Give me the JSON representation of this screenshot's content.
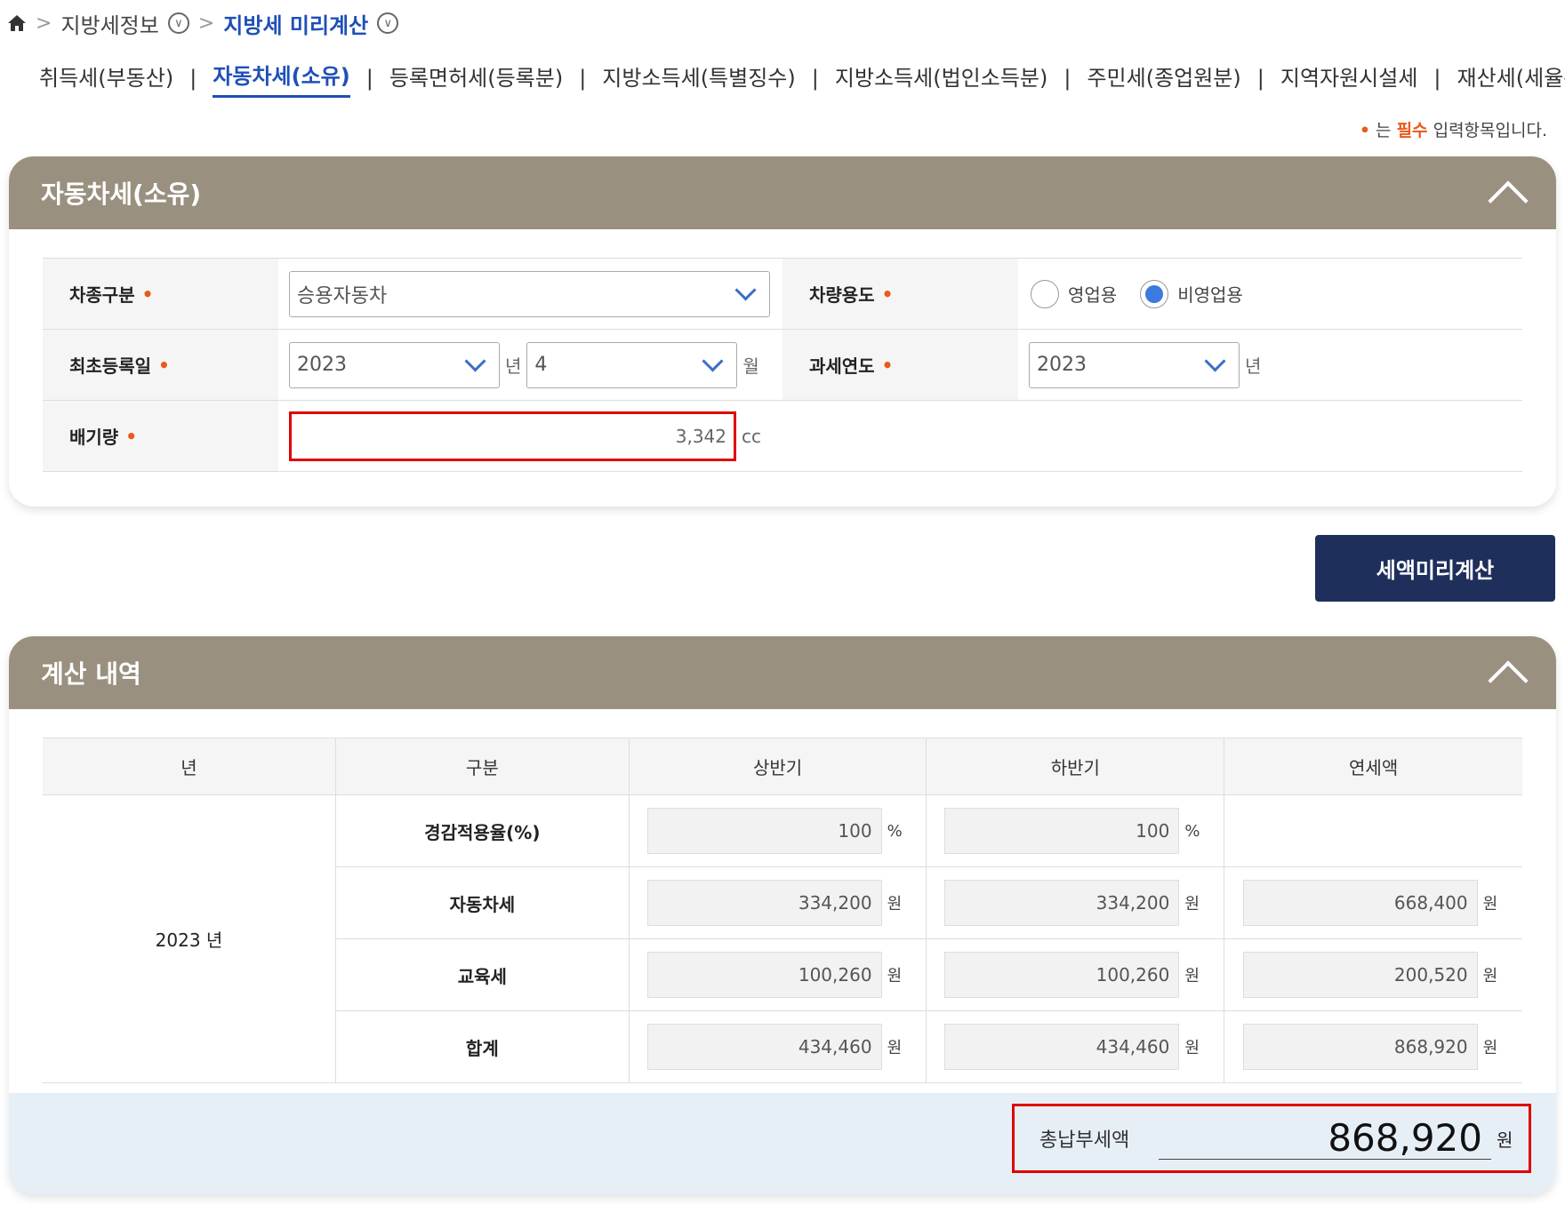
{
  "breadcrumb": {
    "level1": "지방세정보",
    "level2": "지방세 미리계산"
  },
  "tabs": [
    {
      "label": "취득세(부동산)"
    },
    {
      "label": "자동차세(소유)"
    },
    {
      "label": "등록면허세(등록분)"
    },
    {
      "label": "지방소득세(특별징수)"
    },
    {
      "label": "지방소득세(법인소득분)"
    },
    {
      "label": "주민세(종업원분)"
    },
    {
      "label": "지역자원시설세"
    },
    {
      "label": "재산세(세율특례)"
    }
  ],
  "required_note": {
    "dot": "•",
    "pre": "는 ",
    "em": "필수",
    "post": " 입력항목입니다."
  },
  "form_panel": {
    "title": "자동차세(소유)",
    "required_dot": "•",
    "vehicle_type": {
      "label": "차종구분",
      "value": "승용자동차"
    },
    "usage": {
      "label": "차량용도",
      "options": [
        "영업용",
        "비영업용"
      ],
      "selected": "비영업용"
    },
    "first_reg": {
      "label": "최초등록일",
      "year": "2023",
      "year_unit": "년",
      "month": "4",
      "month_unit": "월"
    },
    "tax_year": {
      "label": "과세연도",
      "value": "2023",
      "unit": "년"
    },
    "displacement": {
      "label": "배기량",
      "value": "3,342",
      "unit": "cc"
    }
  },
  "calc_button": "세액미리계산",
  "result_panel": {
    "title": "계산 내역",
    "headers": [
      "년",
      "구분",
      "상반기",
      "하반기",
      "연세액"
    ],
    "year_label": "2023 년",
    "rows": [
      {
        "kind": "경감적용율(%)",
        "h1": "100",
        "h2": "100",
        "annual": "",
        "unit": "%"
      },
      {
        "kind": "자동차세",
        "h1": "334,200",
        "h2": "334,200",
        "annual": "668,400",
        "unit": "원"
      },
      {
        "kind": "교육세",
        "h1": "100,260",
        "h2": "100,260",
        "annual": "200,520",
        "unit": "원"
      },
      {
        "kind": "합계",
        "h1": "434,460",
        "h2": "434,460",
        "annual": "868,920",
        "unit": "원"
      }
    ],
    "total": {
      "label": "총납부세액",
      "value": "868,920",
      "unit": "원"
    }
  }
}
